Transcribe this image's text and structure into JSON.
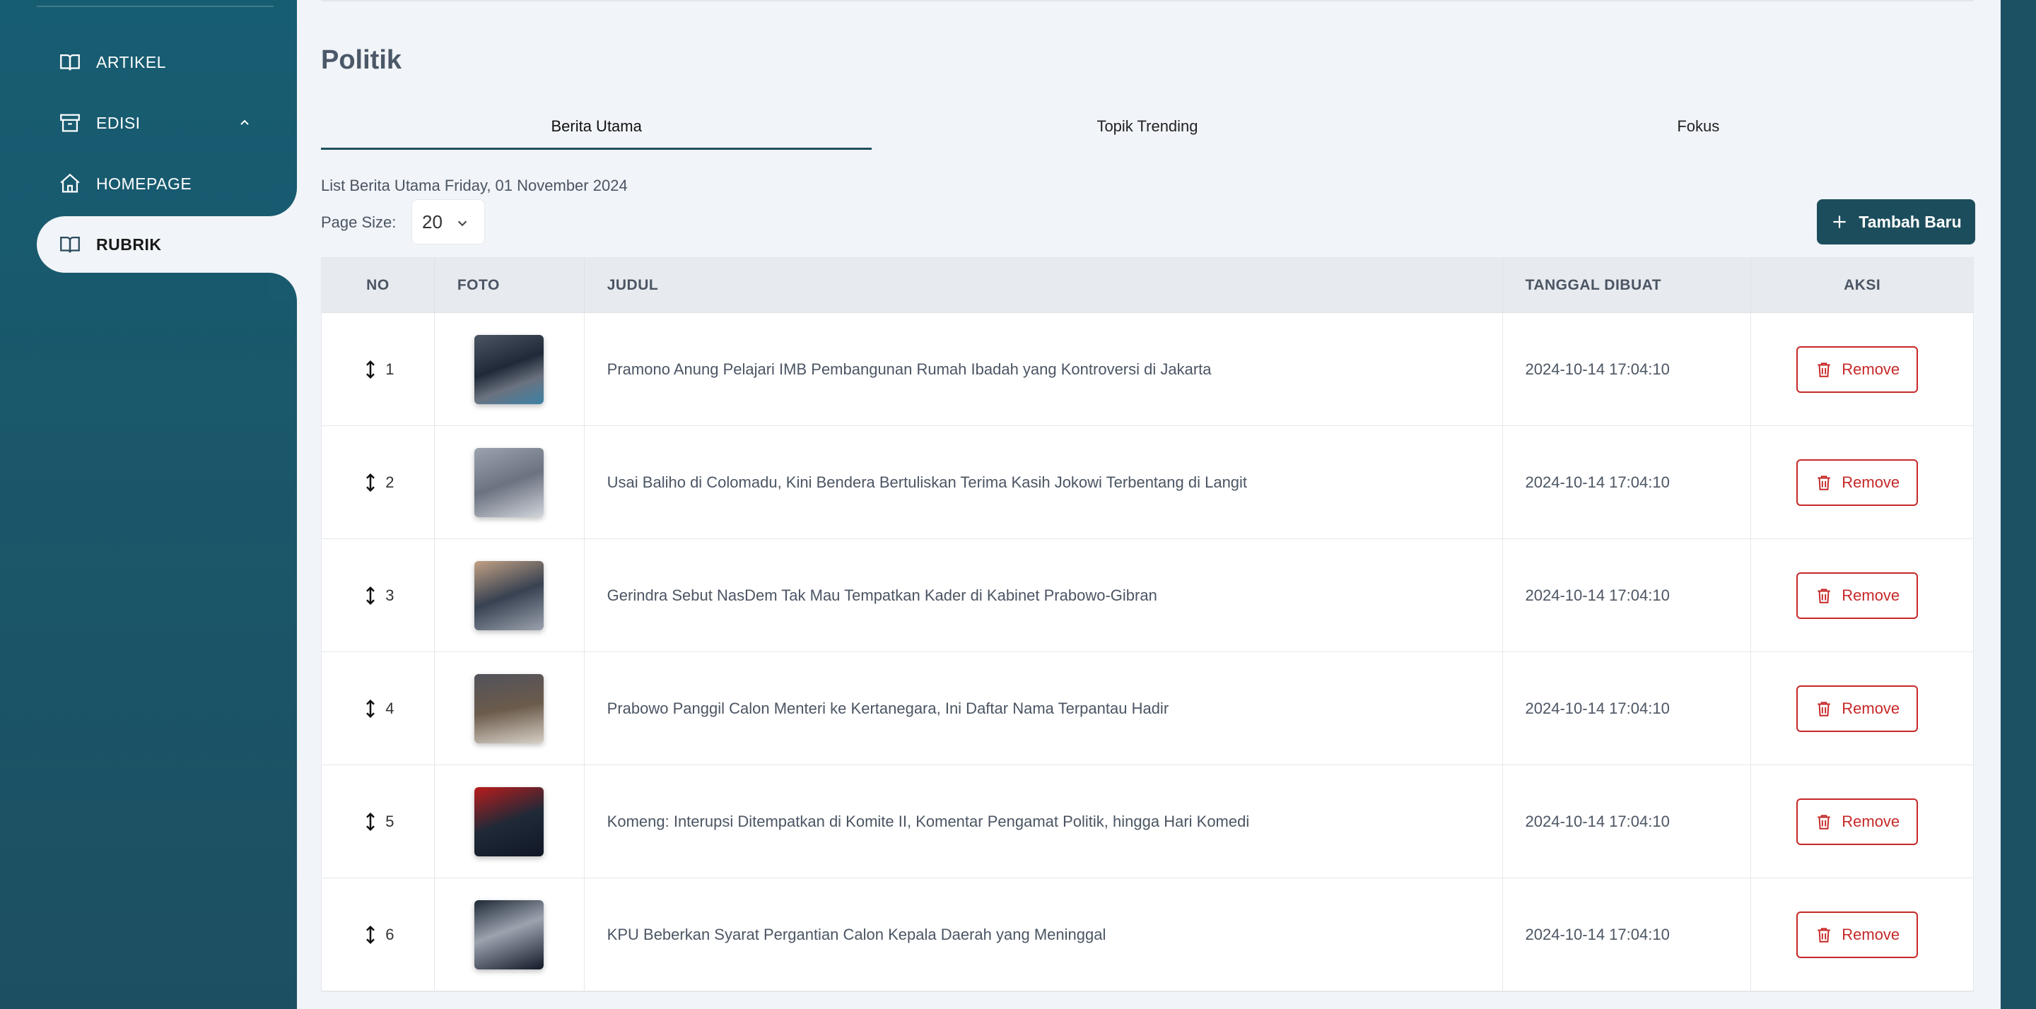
{
  "sidebar": {
    "items": [
      {
        "label": "ARTIKEL",
        "icon": "book-open-icon"
      },
      {
        "label": "EDISI",
        "icon": "archive-icon",
        "expanded": true
      },
      {
        "label": "HOMEPAGE",
        "icon": "home-icon"
      },
      {
        "label": "RUBRIK",
        "icon": "book-open-icon",
        "active": true
      }
    ]
  },
  "page": {
    "title": "Politik",
    "tabs": [
      "Berita Utama",
      "Topik Trending",
      "Fokus"
    ],
    "active_tab": "Berita Utama",
    "list_caption": "List Berita Utama Friday, 01 November 2024",
    "page_size_label": "Page Size:",
    "page_size_value": "20",
    "add_button": "Tambah Baru"
  },
  "table": {
    "headers": {
      "no": "NO",
      "foto": "FOTO",
      "judul": "JUDUL",
      "tanggal": "TANGGAL DIBUAT",
      "aksi": "AKSI"
    },
    "remove_label": "Remove",
    "rows": [
      {
        "no": "1",
        "judul": "Pramono Anung Pelajari IMB Pembangunan Rumah Ibadah yang Kontroversi di Jakarta",
        "tanggal": "2024-10-14 17:04:10"
      },
      {
        "no": "2",
        "judul": "Usai Baliho di Colomadu, Kini Bendera Bertuliskan Terima Kasih Jokowi Terbentang di Langit",
        "tanggal": "2024-10-14 17:04:10"
      },
      {
        "no": "3",
        "judul": "Gerindra Sebut NasDem Tak Mau Tempatkan Kader di Kabinet Prabowo-Gibran",
        "tanggal": "2024-10-14 17:04:10"
      },
      {
        "no": "4",
        "judul": "Prabowo Panggil Calon Menteri ke Kertanegara, Ini Daftar Nama Terpantau Hadir",
        "tanggal": "2024-10-14 17:04:10"
      },
      {
        "no": "5",
        "judul": "Komeng: Interupsi Ditempatkan di Komite II, Komentar Pengamat Politik, hingga Hari Komedi",
        "tanggal": "2024-10-14 17:04:10"
      },
      {
        "no": "6",
        "judul": "KPU Beberkan Syarat Pergantian Calon Kepala Daerah yang Meninggal",
        "tanggal": "2024-10-14 17:04:10"
      }
    ]
  },
  "colors": {
    "sidebar": "#1a5a6e",
    "primary_button": "#1c4d5c",
    "danger": "#c62828",
    "main_bg": "#f1f4f8"
  }
}
